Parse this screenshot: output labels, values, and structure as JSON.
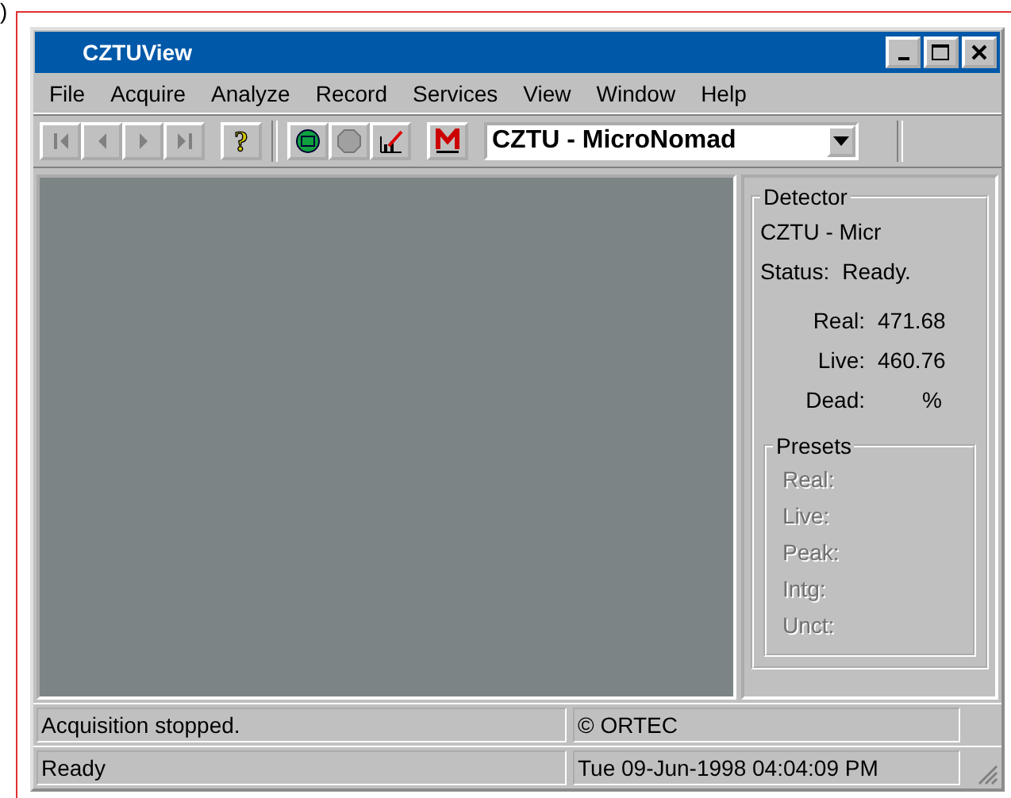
{
  "figure_label": ")",
  "window": {
    "title": "CZTUView"
  },
  "menu": [
    {
      "label": "File"
    },
    {
      "label": "Acquire"
    },
    {
      "label": "Analyze"
    },
    {
      "label": "Record"
    },
    {
      "label": "Services"
    },
    {
      "label": "View"
    },
    {
      "label": "Window"
    },
    {
      "label": "Help"
    }
  ],
  "toolbar": {
    "buttons": [
      {
        "kind": "first",
        "disabled": true
      },
      {
        "kind": "prev",
        "disabled": true
      },
      {
        "kind": "next",
        "disabled": true
      },
      {
        "kind": "last",
        "disabled": true
      },
      {
        "kind": "help",
        "label": "?",
        "disabled": false
      },
      {
        "kind": "go",
        "disabled": false
      },
      {
        "kind": "stop",
        "disabled": true
      },
      {
        "kind": "chart",
        "disabled": false
      },
      {
        "kind": "mark",
        "disabled": false
      }
    ],
    "detector_select": {
      "value": "CZTU - MicroNomad"
    }
  },
  "detector": {
    "title": "Detector",
    "name": "CZTU - Micr",
    "status_label": "Status:",
    "status": "Ready.",
    "readings": [
      {
        "label": "Real:",
        "value": "471.68"
      },
      {
        "label": "Live:",
        "value": "460.76"
      },
      {
        "label": "Dead:",
        "value": "%"
      }
    ]
  },
  "presets": {
    "title": "Presets",
    "items": [
      {
        "label": "Real:",
        "disabled": true
      },
      {
        "label": "Live:",
        "disabled": true
      },
      {
        "label": "Peak:",
        "disabled": true
      },
      {
        "label": "Intg:",
        "disabled": true
      },
      {
        "label": "Unct:",
        "disabled": true
      }
    ]
  },
  "status_bar": [
    {
      "left": "Acquisition stopped.",
      "right": "© ORTEC"
    },
    {
      "left": "Ready",
      "right": "Tue 09-Jun-1998  04:04:09 PM"
    }
  ]
}
